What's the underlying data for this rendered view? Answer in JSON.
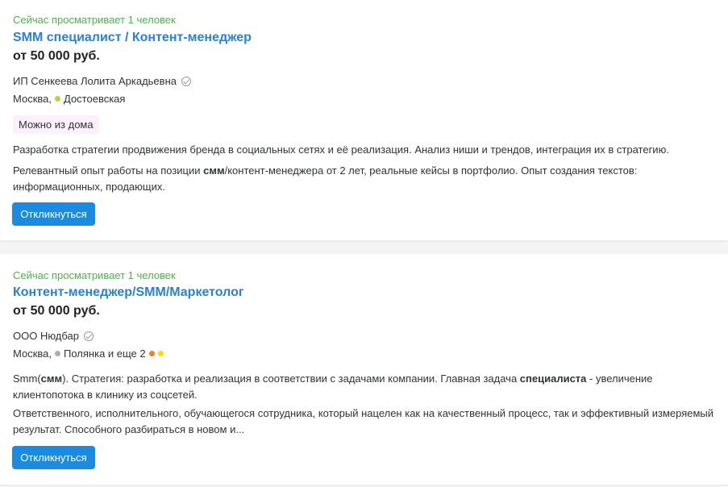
{
  "vacancies": [
    {
      "viewers": "Сейчас просматривает 1 человек",
      "title": "SMM специалист / Контент-менеджер",
      "salary": "от 50 000 руб.",
      "company": "ИП Сенкеева Лолита Аркадьевна",
      "city": "Москва,",
      "metro": "Достоевская",
      "metro_color": "#b4d445",
      "tag": "Можно из дома",
      "desc1_parts": [
        "Разработка стратегии продвижения бренда в социальных сетях и её реализация. Анализ ниши и трендов, интеграция их в стратегию."
      ],
      "desc2_parts": [
        "Релевантный опыт работы на позиции ",
        "смм",
        "/контент-менеджера от 2 лет, реальные кейсы в портфолио. Опыт создания текстов: информационных, продающих."
      ],
      "button": "Откликнуться"
    },
    {
      "viewers": "Сейчас просматривает 1 человек",
      "title": "Контент-менеджер/SMM/Маркетолог",
      "salary": "от 50 000 руб.",
      "company": "ООО Нюдбар",
      "city": "Москва,",
      "metro": "Полянка и еще 2",
      "metro_color": "#adacac",
      "extra_dot_colors": [
        "#ef7e24",
        "#ffd803"
      ],
      "desc1_parts": [
        "Smm(",
        "смм",
        "). Стратегия: разработка и реализация в соответствии с задачами компании. Главная задача ",
        "специалиста",
        " - увеличение клиентопотока в клинику из соцсетей."
      ],
      "desc2_parts": [
        "Ответственного, исполнительного, обучающегося сотрудника, который нацелен как на качественный процесс, так и эффективный измеряемый результат. Способного разбираться в новом и..."
      ],
      "button": "Откликнуться"
    }
  ]
}
